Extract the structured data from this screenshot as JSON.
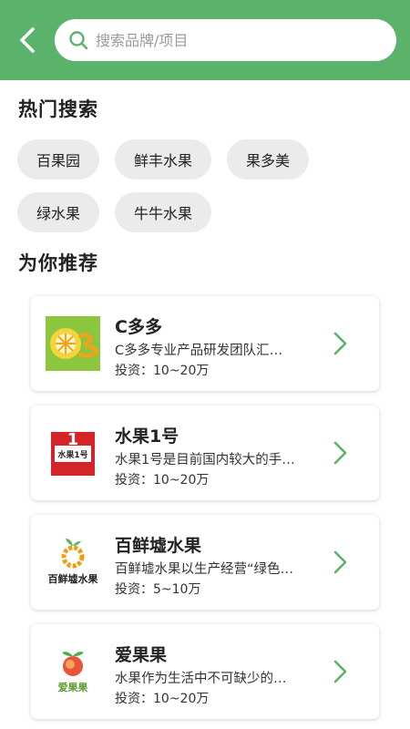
{
  "header": {
    "back_icon": "chevron-left-icon",
    "search": {
      "placeholder": "搜索品牌/项目",
      "value": "",
      "icon": "search-icon"
    }
  },
  "hot_search": {
    "title": "热门搜索",
    "tags": [
      "百果园",
      "鲜丰水果",
      "果多美",
      "绿水果",
      "牛牛水果"
    ]
  },
  "recommend": {
    "title": "为你推荐",
    "items": [
      {
        "name": "C多多",
        "desc": "C多多专业产品研发团队汇…",
        "invest": "投资：10~20万"
      },
      {
        "name": "水果1号",
        "desc": "水果1号是目前国内较大的手…",
        "invest": "投资：10~20万",
        "logo_text": "水果1号",
        "logo_number": "1"
      },
      {
        "name": "百鲜墟水果",
        "desc": "百鲜墟水果以生产经营“绿色…",
        "invest": "投资：5~10万",
        "logo_text": "百鲜墟水果"
      },
      {
        "name": "爱果果",
        "desc": "水果作为生活中不可缺少的…",
        "invest": "投资：10~20万",
        "logo_text": "爱果果"
      }
    ]
  },
  "colors": {
    "header_bg": "#5bb36b",
    "accent": "#5bb36b",
    "tag_bg": "#ebebeb"
  }
}
